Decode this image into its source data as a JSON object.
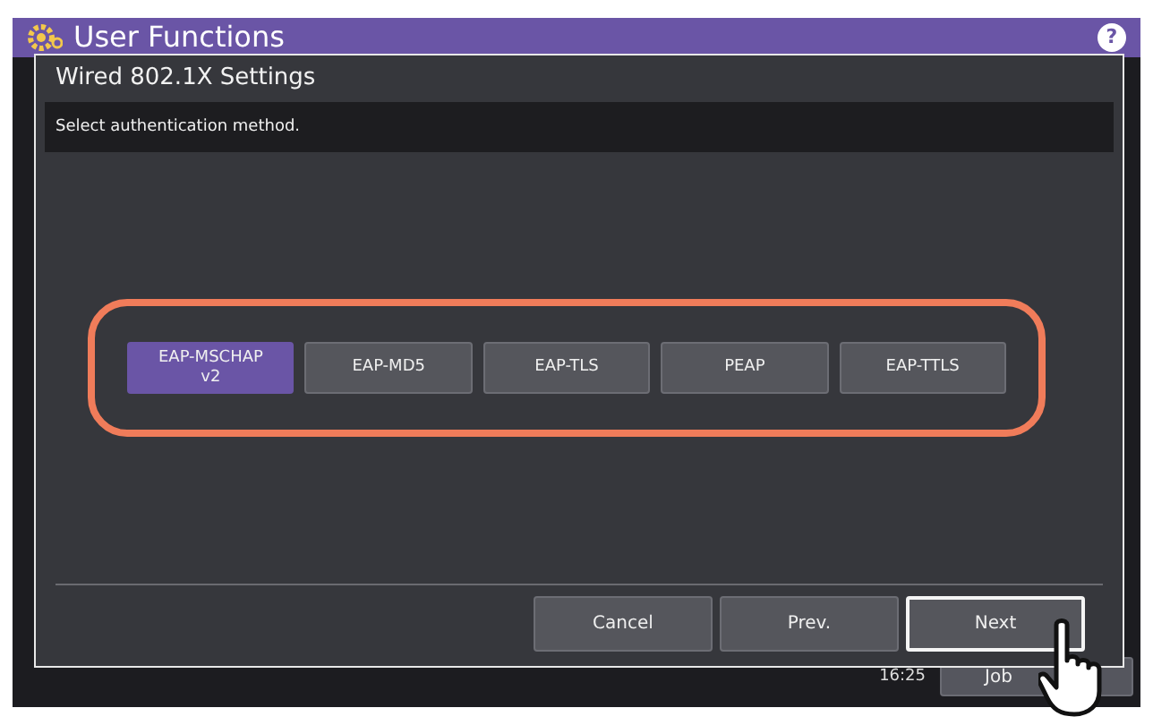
{
  "app_header": {
    "title": "User Functions",
    "help_button": "?"
  },
  "dialog": {
    "title": "Wired 802.1X Settings",
    "message": "Select authentication method.",
    "methods": [
      {
        "label": "EAP-MSCHAP v2",
        "selected": true
      },
      {
        "label": "EAP-MD5",
        "selected": false
      },
      {
        "label": "EAP-TLS",
        "selected": false
      },
      {
        "label": "PEAP",
        "selected": false
      },
      {
        "label": "EAP-TTLS",
        "selected": false
      }
    ],
    "buttons": [
      {
        "label": "Cancel",
        "focused": false
      },
      {
        "label": "Prev.",
        "focused": false
      },
      {
        "label": "Next",
        "focused": true
      }
    ]
  },
  "status_bar": {
    "time": "16:25",
    "job_button": "Job"
  }
}
